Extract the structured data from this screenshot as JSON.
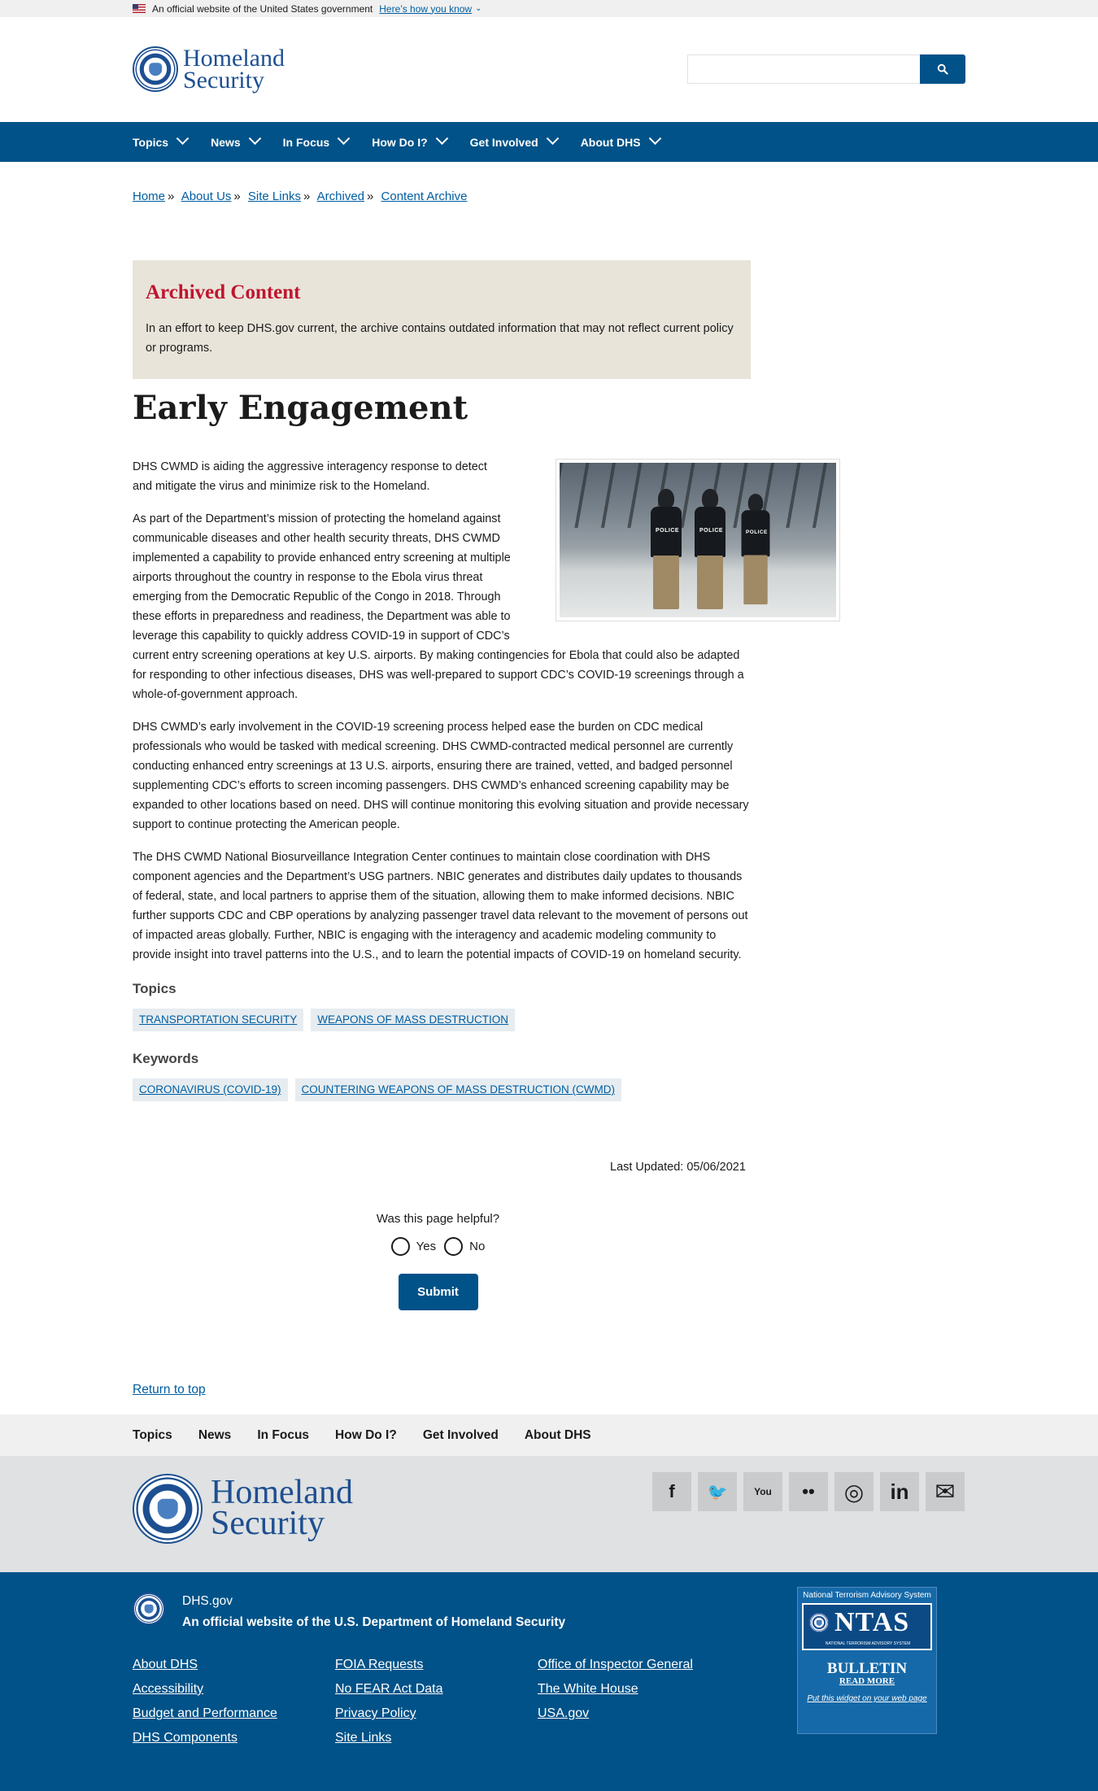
{
  "gov_banner": {
    "text": "An official website of the United States government",
    "link": "Here’s how you know"
  },
  "header": {
    "logo_line1": "Homeland",
    "logo_line2": "Security",
    "search_placeholder": ""
  },
  "nav": {
    "items": [
      {
        "label": "Topics"
      },
      {
        "label": "News"
      },
      {
        "label": "In Focus"
      },
      {
        "label": "How Do I?"
      },
      {
        "label": "Get Involved"
      },
      {
        "label": "About DHS"
      }
    ]
  },
  "breadcrumb": [
    "Home",
    "About Us",
    "Site Links",
    "Archived",
    "Content Archive"
  ],
  "archived": {
    "title": "Archived Content",
    "text": "In an effort to keep DHS.gov current, the archive contains outdated information that may not reflect current policy or programs."
  },
  "page_title": "Early Engagement",
  "body": {
    "p1": "DHS CWMD is aiding the aggressive interagency response to detect and mitigate the virus and minimize risk to the Homeland.",
    "p2": "As part of the Department’s mission of protecting the homeland against communicable diseases and other health security threats, DHS CWMD implemented a capability to provide enhanced entry screening at multiple airports throughout the country in response to the Ebola virus threat emerging from the Democratic Republic of the Congo in 2018. Through these efforts in preparedness and readiness, the Department was able to leverage this capability to quickly address COVID-19 in support of CDC’s current entry screening operations at key U.S. airports. By making contingencies for Ebola that could also be adapted for responding to other infectious diseases, DHS was well-prepared to support CDC’s COVID-19 screenings through a whole-of-government approach.",
    "p3": "DHS CWMD’s early involvement in the COVID-19 screening process helped ease the burden on CDC medical professionals who would be tasked with medical screening. DHS CWMD-contracted medical personnel are currently conducting enhanced entry screenings at 13 U.S. airports, ensuring there are trained, vetted, and badged personnel supplementing CDC’s efforts to screen incoming passengers. DHS CWMD’s enhanced screening capability may be expanded to other locations based on need. DHS will continue monitoring this evolving situation and provide necessary support to continue protecting the American people.",
    "p4": "The DHS CWMD National Biosurveillance Integration Center continues to maintain close coordination with DHS component agencies and the Department’s USG partners. NBIC generates and distributes daily updates to thousands of federal, state, and local partners to apprise them of the situation, allowing them to make informed decisions. NBIC further supports CDC and CBP operations by analyzing passenger travel data relevant to the movement of persons out of impacted areas globally. Further, NBIC is engaging with the interagency and academic modeling community to provide insight into travel patterns into the U.S., and to learn the potential impacts of COVID-19 on homeland security.",
    "photo_tag": "POLICE"
  },
  "topics": {
    "heading": "Topics",
    "items": [
      "TRANSPORTATION SECURITY",
      "WEAPONS OF MASS DESTRUCTION"
    ]
  },
  "keywords": {
    "heading": "Keywords",
    "items": [
      "CORONAVIRUS (COVID-19)",
      "COUNTERING WEAPONS OF MASS DESTRUCTION (CWMD)"
    ]
  },
  "last_updated": "Last Updated: 05/06/2021",
  "feedback": {
    "question": "Was this page helpful?",
    "yes": "Yes",
    "no": "No",
    "submit": "Submit"
  },
  "return_top": "Return to top",
  "footer_nav": [
    "Topics",
    "News",
    "In Focus",
    "How Do I?",
    "Get Involved",
    "About DHS"
  ],
  "footer_logo": {
    "line1": "Homeland",
    "line2": "Security"
  },
  "socials": [
    {
      "icon": "facebook-icon",
      "glyph": "f"
    },
    {
      "icon": "twitter-icon",
      "glyph": "🐦"
    },
    {
      "icon": "youtube-icon",
      "glyph": "You"
    },
    {
      "icon": "flickr-icon",
      "glyph": "••"
    },
    {
      "icon": "instagram-icon",
      "glyph": "◎"
    },
    {
      "icon": "linkedin-icon",
      "glyph": "in"
    },
    {
      "icon": "email-icon",
      "glyph": "✉"
    }
  ],
  "identifier": {
    "domain": "DHS.gov",
    "official_prefix": "An official website of the ",
    "agency": "U.S. Department of Homeland Security"
  },
  "footer_links": [
    "About DHS",
    "FOIA Requests",
    "Office of Inspector General",
    "Accessibility",
    "No FEAR Act Data",
    "The White House",
    "Budget and Performance",
    "Privacy Policy",
    "USA.gov",
    "DHS Components",
    "Site Links",
    ""
  ],
  "ntas": {
    "title": "National Terrorism Advisory System",
    "logo": "NTAS",
    "subtitle": "NATIONAL TERRORISM ADVISORY SYSTEM",
    "bulletin": "BULLETIN",
    "read_more": "READ MORE",
    "widget": "Put this widget on your web page"
  },
  "colors": {
    "primary": "#005288",
    "link": "#005ea2",
    "archived_red": "#c0142f",
    "archived_bg": "#e8e4d9"
  }
}
